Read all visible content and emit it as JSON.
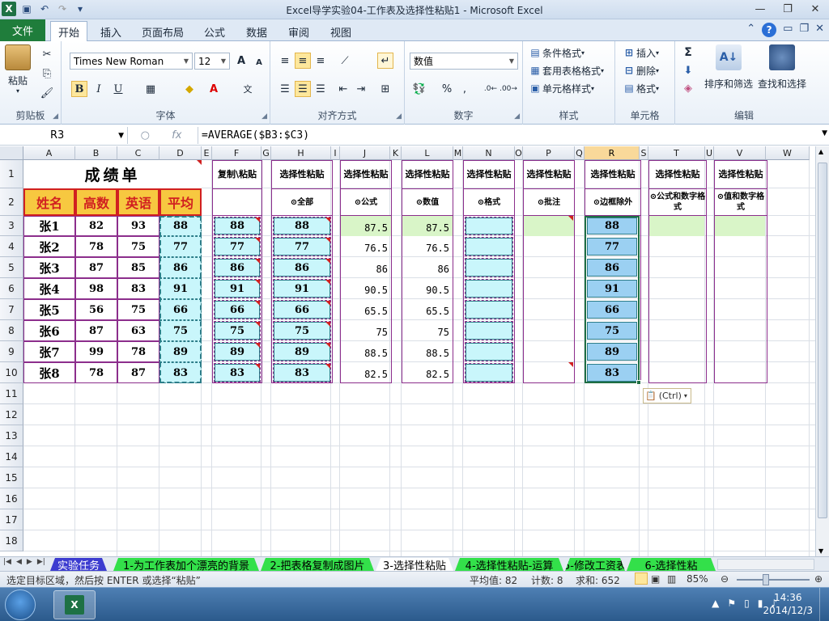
{
  "window": {
    "title": "Excel导学实验04-工作表及选择性粘贴1  -  Microsoft Excel"
  },
  "ribbon_tabs": [
    "文件",
    "开始",
    "插入",
    "页面布局",
    "公式",
    "数据",
    "审阅",
    "视图"
  ],
  "ribbon": {
    "clipboard": {
      "paste": "粘贴",
      "label": "剪贴板"
    },
    "font": {
      "name": "Times New Roman",
      "size": "12",
      "label": "字体",
      "bold": "B",
      "italic": "I",
      "underline": "U",
      "grow": "A",
      "shrink": "A"
    },
    "align": {
      "label": "对齐方式"
    },
    "number": {
      "format": "数值",
      "label": "数字",
      "percent": "%",
      "comma": ","
    },
    "styles": {
      "cond": "条件格式",
      "table": "套用表格格式",
      "cell": "单元格样式",
      "label": "样式"
    },
    "cells": {
      "insert": "插入",
      "delete": "删除",
      "format": "格式",
      "label": "单元格"
    },
    "editing": {
      "sum": "Σ",
      "sort": "排序和筛选",
      "find": "查找和选择",
      "label": "编辑"
    }
  },
  "formula_bar": {
    "name_box": "R3",
    "fx": "fx",
    "formula": "=AVERAGE($B3:$C3)"
  },
  "columns": [
    "A",
    "B",
    "C",
    "D",
    "E",
    "F",
    "G",
    "H",
    "I",
    "J",
    "K",
    "L",
    "M",
    "N",
    "O",
    "P",
    "Q",
    "R",
    "S",
    "T",
    "U",
    "V",
    "W"
  ],
  "rows": [
    "1",
    "2",
    "3",
    "4",
    "5",
    "6",
    "7",
    "8",
    "9",
    "10",
    "11",
    "12",
    "13",
    "14",
    "15",
    "16",
    "17",
    "18"
  ],
  "sheet": {
    "title": "成绩单",
    "headers": [
      "姓名",
      "高数",
      "英语",
      "平均"
    ],
    "names": [
      "张1",
      "张2",
      "张3",
      "张4",
      "张5",
      "张6",
      "张7",
      "张8"
    ],
    "math": [
      "82",
      "78",
      "87",
      "98",
      "56",
      "87",
      "99",
      "78"
    ],
    "english": [
      "93",
      "75",
      "85",
      "83",
      "75",
      "63",
      "78",
      "87"
    ],
    "avg": [
      "88",
      "77",
      "86",
      "91",
      "66",
      "75",
      "89",
      "83"
    ],
    "paste_titles": {
      "F": "复制\\粘贴",
      "H": "选择性粘贴",
      "J": "选择性粘贴",
      "L": "选择性粘贴",
      "N": "选择性粘贴",
      "P": "选择性粘贴",
      "R": "选择性粘贴",
      "T": "选择性粘贴",
      "V": "选择性粘贴"
    },
    "paste_options": {
      "H": "⊙全部",
      "J": "⊙公式",
      "L": "⊙数值",
      "N": "⊙格式",
      "P": "⊙批注",
      "R": "⊙边框除外",
      "T": "⊙公式和数字格式",
      "V": "⊙值和数字格式"
    },
    "decimals": [
      "87.5",
      "76.5",
      "86",
      "90.5",
      "65.5",
      "75",
      "88.5",
      "82.5"
    ]
  },
  "paste_ctrl": "(Ctrl)",
  "sheet_tabs": [
    {
      "label": "实验任务",
      "color": "#3c3cd0",
      "text": "#ffffff"
    },
    {
      "label": "1-为工作表加个漂亮的背景",
      "color": "#33e04a",
      "text": "#000000"
    },
    {
      "label": "2-把表格复制成图片",
      "color": "#33e04a",
      "text": "#000000"
    },
    {
      "label": "3-选择性粘贴",
      "color": "#ffffff",
      "text": "#000000"
    },
    {
      "label": "4-选择性粘贴-运算",
      "color": "#33e04a",
      "text": "#000000"
    },
    {
      "label": "5-修改工资表",
      "color": "#33e04a",
      "text": "#000000"
    },
    {
      "label": "6-选择性粘",
      "color": "#33e04a",
      "text": "#000000"
    }
  ],
  "status": {
    "message": "选定目标区域，然后按 ENTER 或选择“粘贴”",
    "average": "平均值: 82",
    "count": "计数: 8",
    "sum": "求和: 652",
    "zoom": "85%"
  },
  "taskbar": {
    "time": "14:36",
    "date": "2014/12/3"
  }
}
